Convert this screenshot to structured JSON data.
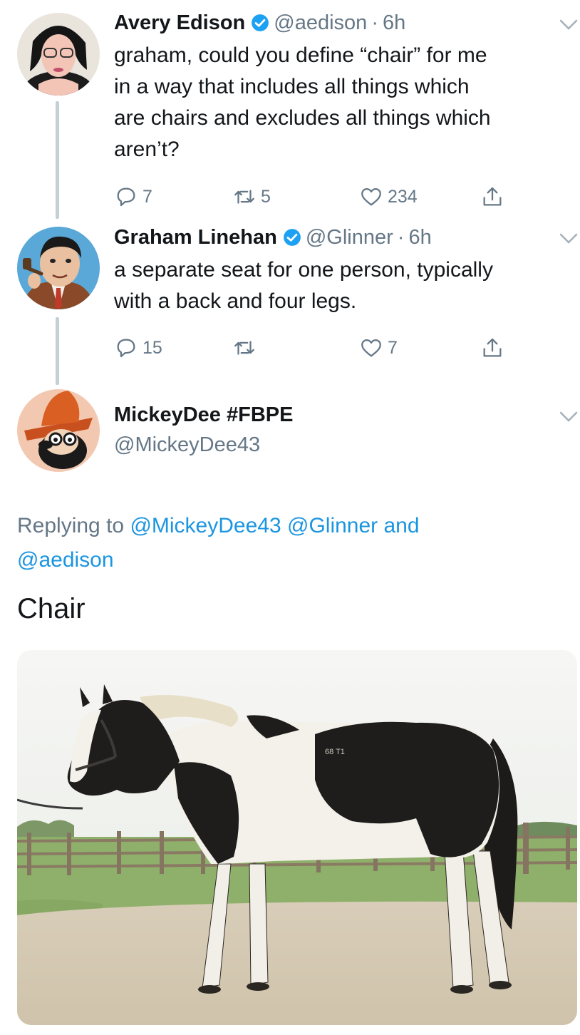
{
  "tweets": [
    {
      "display_name": "Avery Edison",
      "handle": "@aedison",
      "separator": "·",
      "time": "6h",
      "verified": true,
      "lines": [
        "graham, could you define “chair” for me",
        "in a way that includes all things which",
        "are chairs and excludes all things which",
        "aren’t?"
      ],
      "replies": "7",
      "retweets": "5",
      "likes": "234"
    },
    {
      "display_name": "Graham Linehan",
      "handle": "@Glinner",
      "separator": "·",
      "time": "6h",
      "verified": true,
      "lines": [
        "a separate seat for one person, typically",
        "with a back and four legs."
      ],
      "replies": "15",
      "retweets": "",
      "likes": "7"
    }
  ],
  "main_tweet": {
    "display_name": "MickeyDee #FBPE",
    "handle": "@MickeyDee43",
    "replying_prefix": "Replying to",
    "replying_handles": [
      "@MickeyDee43",
      "@Glinner"
    ],
    "replying_and": "and",
    "replying_last": "@aedison",
    "text": "Chair"
  },
  "image_photo_marking": "68 T1",
  "icons": [
    "reply-icon",
    "retweet-icon",
    "like-icon",
    "share-icon",
    "verified-badge-icon",
    "chevron-down-icon"
  ],
  "colors": {
    "text": "#14171a",
    "secondary": "#657786",
    "link": "#1b95e0",
    "verified": "#1da1f2",
    "thread_line": "#c4cfd6"
  }
}
